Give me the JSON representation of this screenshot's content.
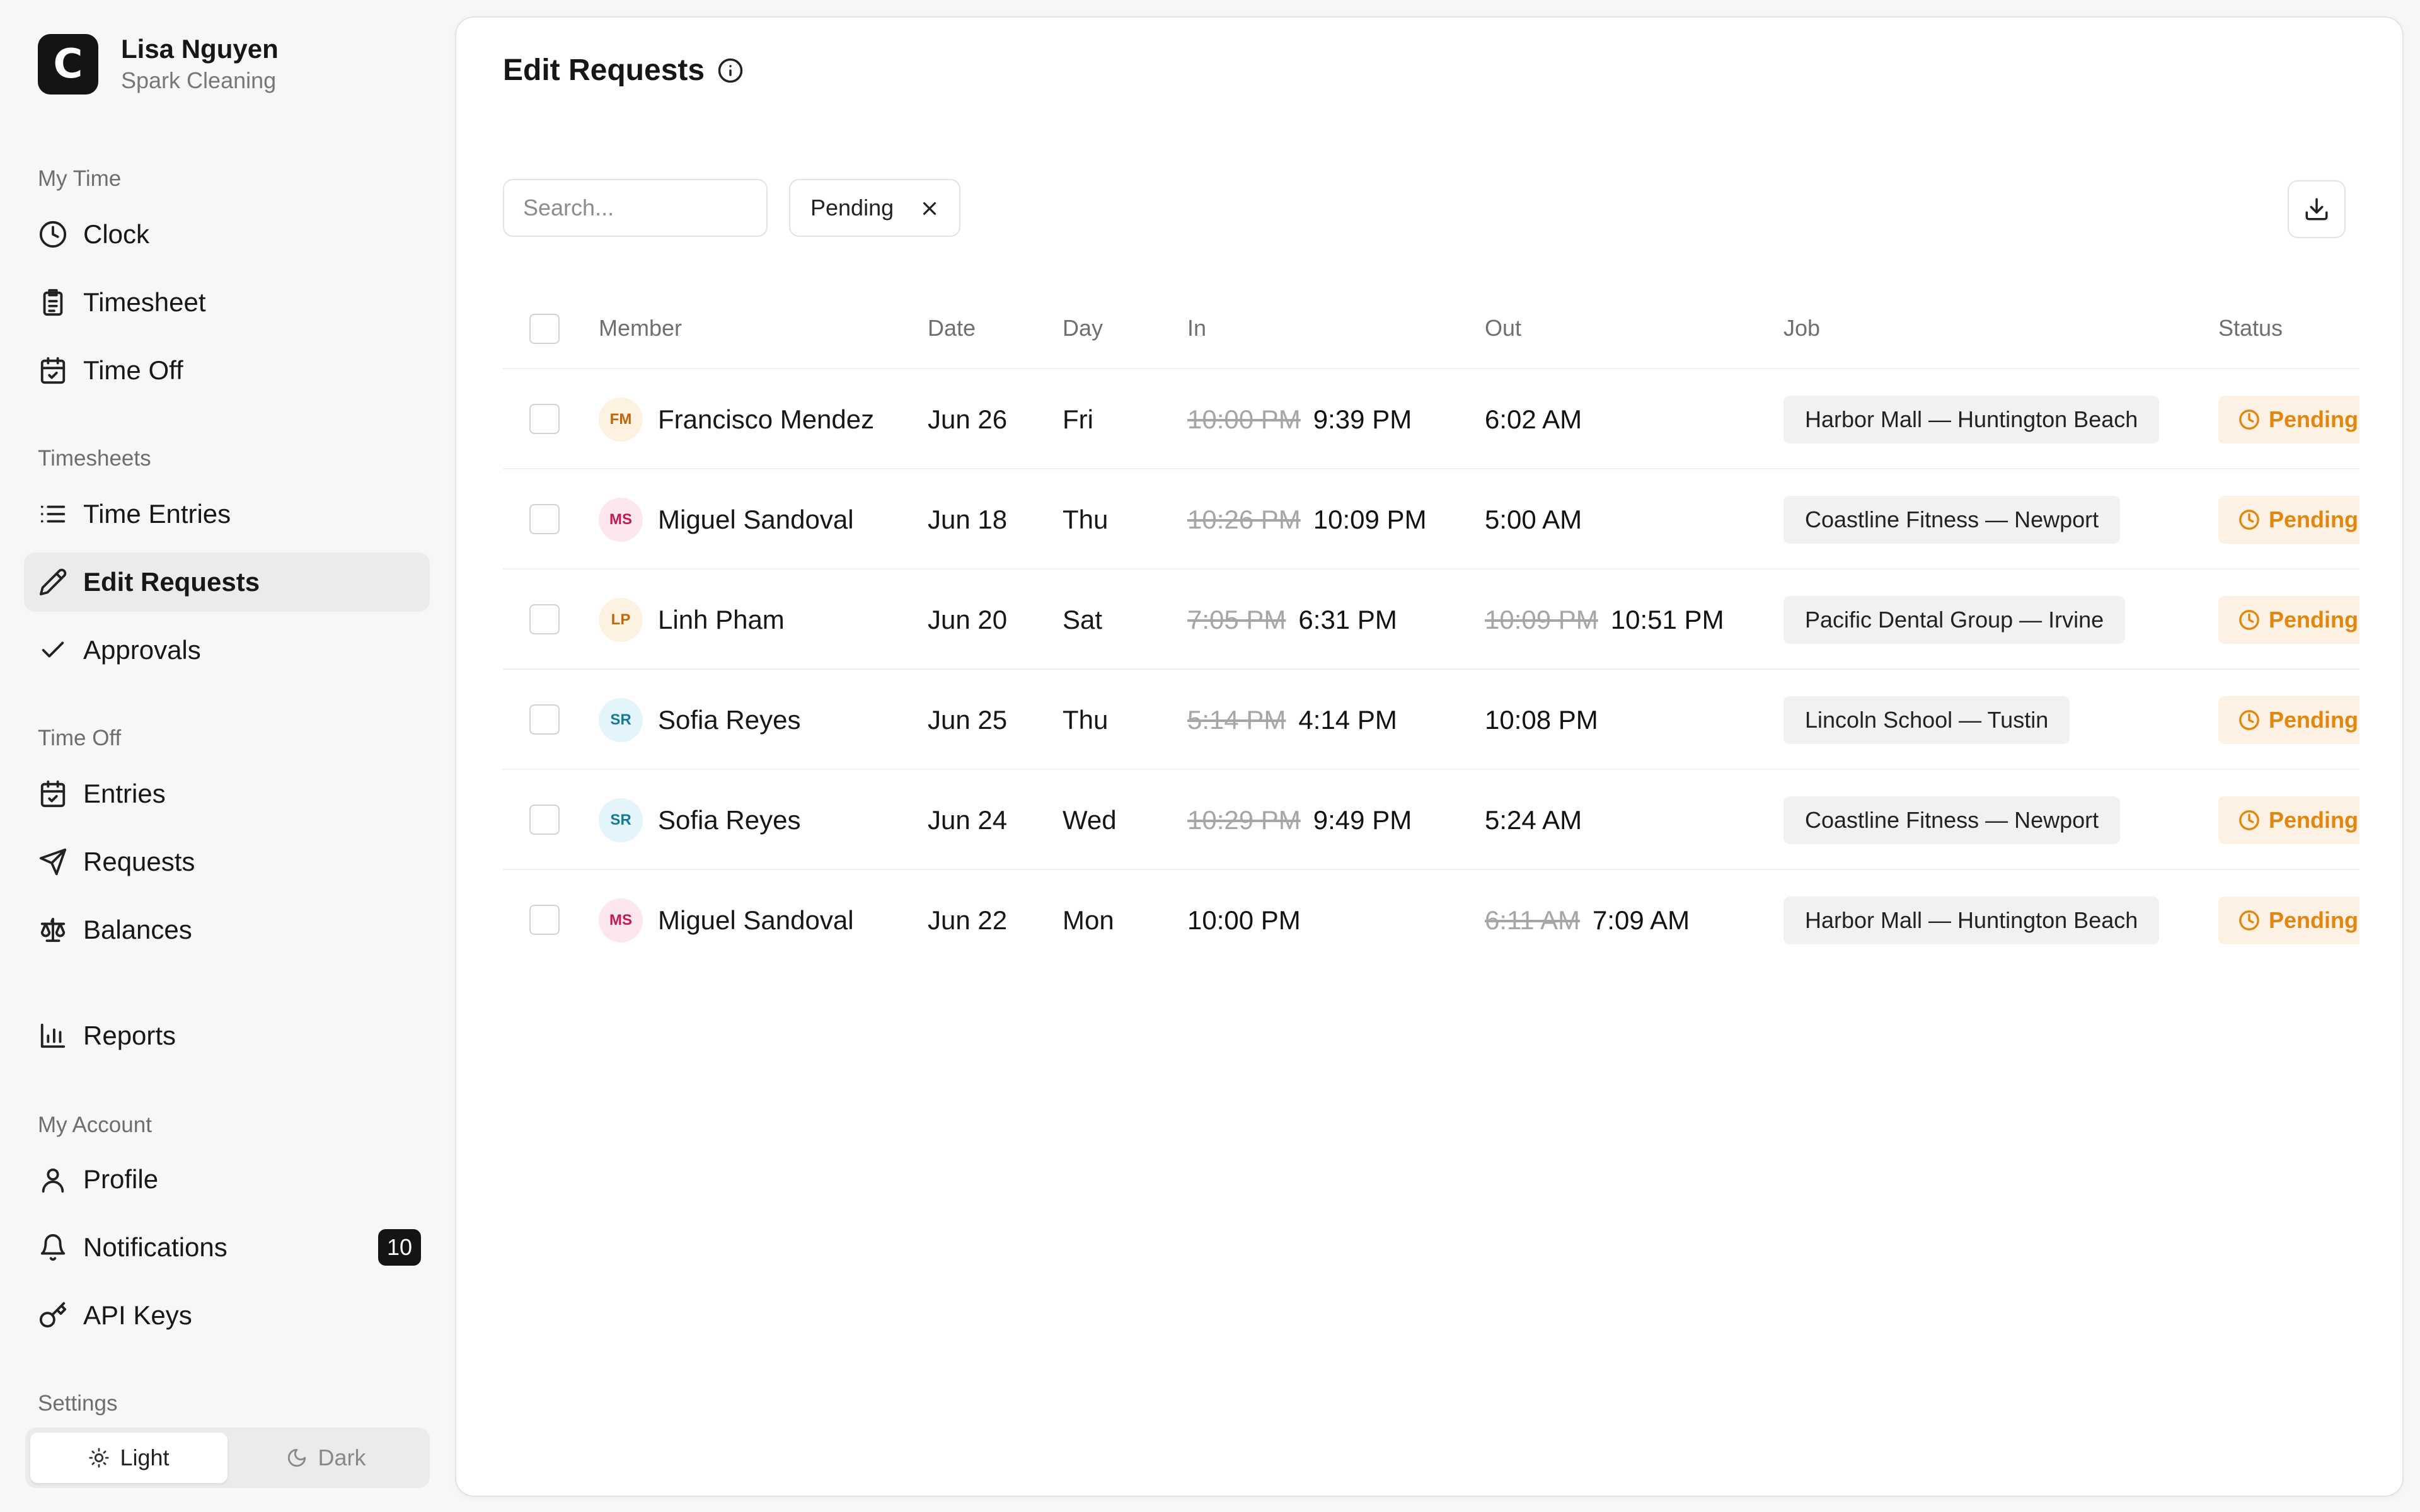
{
  "user": {
    "name": "Lisa Nguyen",
    "org": "Spark Cleaning",
    "logo_letter": "C"
  },
  "sidebar": {
    "sections": [
      {
        "label": "My Time",
        "items": [
          {
            "label": "Clock",
            "icon": "clock-icon"
          },
          {
            "label": "Timesheet",
            "icon": "clipboard-icon"
          },
          {
            "label": "Time Off",
            "icon": "calendar-check-icon"
          }
        ]
      },
      {
        "label": "Timesheets",
        "items": [
          {
            "label": "Time Entries",
            "icon": "list-icon"
          },
          {
            "label": "Edit Requests",
            "icon": "pencil-icon",
            "active": true
          },
          {
            "label": "Approvals",
            "icon": "check-icon"
          }
        ]
      },
      {
        "label": "Time Off",
        "items": [
          {
            "label": "Entries",
            "icon": "calendar-check-icon"
          },
          {
            "label": "Requests",
            "icon": "send-icon"
          },
          {
            "label": "Balances",
            "icon": "scale-icon"
          }
        ]
      },
      {
        "label": "",
        "items": [
          {
            "label": "Reports",
            "icon": "bar-chart-icon"
          }
        ]
      },
      {
        "label": "My Account",
        "items": [
          {
            "label": "Profile",
            "icon": "user-icon"
          },
          {
            "label": "Notifications",
            "icon": "bell-icon",
            "badge": "10"
          },
          {
            "label": "API Keys",
            "icon": "key-icon"
          }
        ]
      }
    ],
    "settings_label": "Settings",
    "theme": {
      "light": "Light",
      "dark": "Dark",
      "selected": "Light"
    }
  },
  "main": {
    "title": "Edit Requests",
    "search_placeholder": "Search...",
    "filter_chip": "Pending",
    "columns": [
      "Member",
      "Date",
      "Day",
      "In",
      "Out",
      "Job",
      "Status"
    ],
    "rows": [
      {
        "initials": "FM",
        "name": "Francisco Mendez",
        "date": "Jun 26",
        "day": "Fri",
        "in_old": "10:00 PM",
        "in_new": "9:39 PM",
        "out_old": "",
        "out_new": "6:02 AM",
        "job": "Harbor Mall — Huntington Beach",
        "status": "Pending",
        "avatar_bg": "#fdf1e2",
        "avatar_fg": "#c2660a"
      },
      {
        "initials": "MS",
        "name": "Miguel Sandoval",
        "date": "Jun 18",
        "day": "Thu",
        "in_old": "10:26 PM",
        "in_new": "10:09 PM",
        "out_old": "",
        "out_new": "5:00 AM",
        "job": "Coastline Fitness — Newport",
        "status": "Pending",
        "avatar_bg": "#fce7ef",
        "avatar_fg": "#c21a52"
      },
      {
        "initials": "LP",
        "name": "Linh Pham",
        "date": "Jun 20",
        "day": "Sat",
        "in_old": "7:05 PM",
        "in_new": "6:31 PM",
        "out_old": "10:09 PM",
        "out_new": "10:51 PM",
        "job": "Pacific Dental Group — Irvine",
        "status": "Pending",
        "avatar_bg": "#fdf1e2",
        "avatar_fg": "#c2660a"
      },
      {
        "initials": "SR",
        "name": "Sofia Reyes",
        "date": "Jun 25",
        "day": "Thu",
        "in_old": "5:14 PM",
        "in_new": "4:14 PM",
        "out_old": "",
        "out_new": "10:08 PM",
        "job": "Lincoln School — Tustin",
        "status": "Pending",
        "avatar_bg": "#e3f5fa",
        "avatar_fg": "#157a94"
      },
      {
        "initials": "SR",
        "name": "Sofia Reyes",
        "date": "Jun 24",
        "day": "Wed",
        "in_old": "10:29 PM",
        "in_new": "9:49 PM",
        "out_old": "",
        "out_new": "5:24 AM",
        "job": "Coastline Fitness — Newport",
        "status": "Pending",
        "avatar_bg": "#e3f5fa",
        "avatar_fg": "#157a94"
      },
      {
        "initials": "MS",
        "name": "Miguel Sandoval",
        "date": "Jun 22",
        "day": "Mon",
        "in_old": "",
        "in_new": "10:00 PM",
        "out_old": "6:11 AM",
        "out_new": "7:09 AM",
        "job": "Harbor Mall — Huntington Beach",
        "status": "Pending",
        "avatar_bg": "#fce7ef",
        "avatar_fg": "#c21a52"
      }
    ]
  },
  "colors": {
    "pending_fg": "#e1860f",
    "pending_bg": "#fdf1e3",
    "accent": "#141414"
  }
}
